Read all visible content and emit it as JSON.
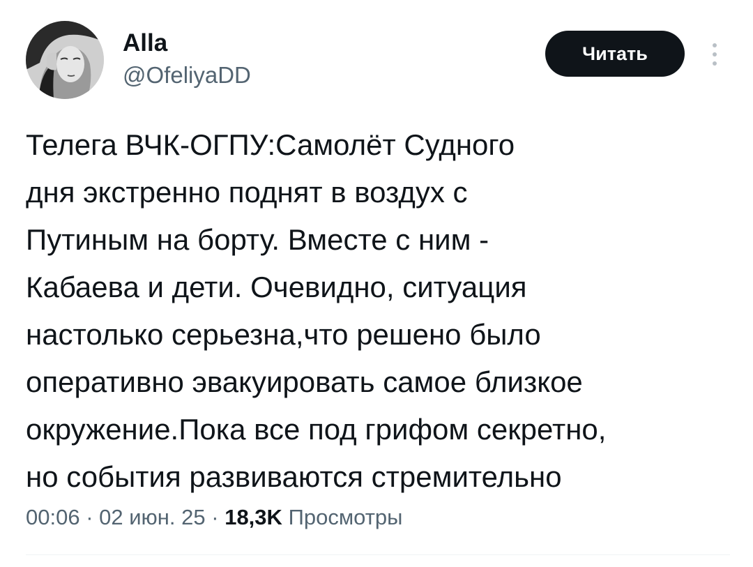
{
  "author": {
    "display_name": "Alla",
    "handle": "@OfeliyaDD"
  },
  "follow_button": {
    "label": "Читать"
  },
  "more_button": {
    "icon": "more-vertical-icon"
  },
  "tweet": {
    "lines": [
      "Телега ВЧК-ОГПУ:Самолёт Судного",
      "дня экстренно поднят в воздух с",
      "Путиным на борту. Вместе с ним -",
      "Кабаева и дети. Очевидно, ситуация",
      "настолько серьезна,что решено было",
      "оперативно эвакуировать самое близкое",
      "окружение.Пока все под грифом секретно,",
      "но события развиваются стремительно"
    ]
  },
  "meta": {
    "time": "00:06",
    "separator": " · ",
    "date": "02 июн. 25",
    "views_count": "18,3K",
    "views_label": "Просмотры"
  },
  "colors": {
    "text_primary": "#0f1419",
    "text_secondary": "#536471",
    "button_bg": "#0f1419",
    "button_text": "#ffffff",
    "divider": "#eff3f4"
  }
}
